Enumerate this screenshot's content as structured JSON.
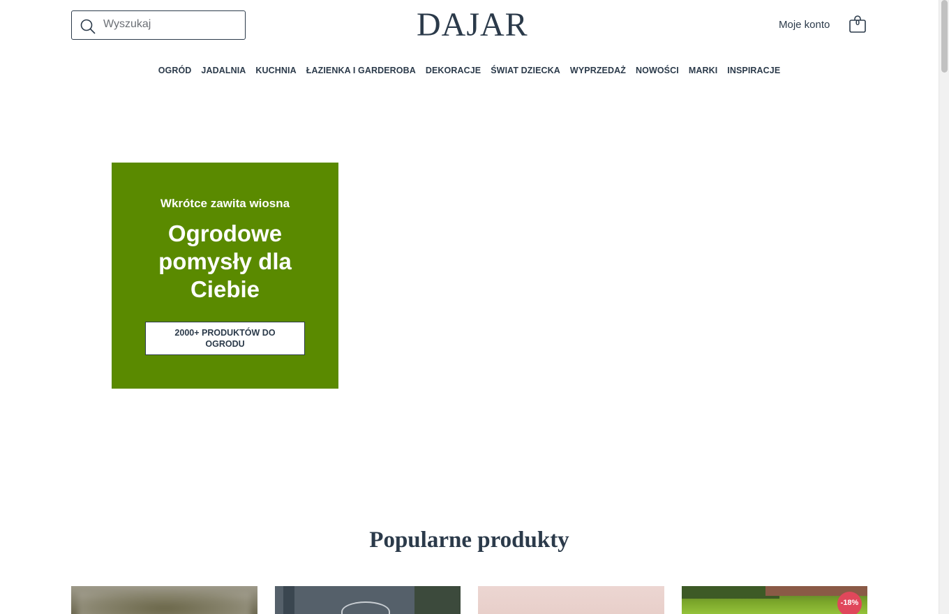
{
  "header": {
    "search_placeholder": "Wyszukaj",
    "logo": "DAJAR",
    "account_label": "Moje konto",
    "cart_count": "0"
  },
  "nav": {
    "items": [
      {
        "label": "OGRÓD"
      },
      {
        "label": "JADALNIA"
      },
      {
        "label": "KUCHNIA"
      },
      {
        "label": "ŁAZIENKA I GARDEROBA"
      },
      {
        "label": "DEKORACJE"
      },
      {
        "label": "ŚWIAT DZIECKA"
      },
      {
        "label": "WYPRZEDAŻ"
      },
      {
        "label": "NOWOŚCI"
      },
      {
        "label": "MARKI"
      },
      {
        "label": "INSPIRACJE"
      }
    ]
  },
  "hero": {
    "kicker": "Wkrótce zawita wiosna",
    "title": "Ogrodowe pomysły dla Ciebie",
    "cta_label": "2000+ PRODUKTÓW DO OGRODU",
    "panel_color": "#5a8a00"
  },
  "popular": {
    "title": "Popularne produkty",
    "products": [
      {
        "discount": ""
      },
      {
        "discount": ""
      },
      {
        "discount": ""
      },
      {
        "discount": "-18%"
      }
    ]
  },
  "colors": {
    "text": "#2b3a4a",
    "accent_green": "#5a8a00",
    "discount_badge": "#e0475b"
  }
}
